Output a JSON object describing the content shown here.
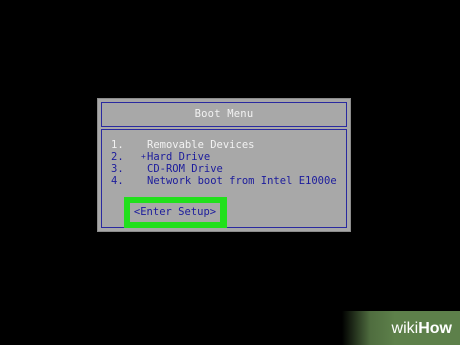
{
  "boot_menu": {
    "title": "Boot Menu",
    "items": [
      {
        "number": "1.",
        "marker": "",
        "label": "Removable Devices",
        "selected": true
      },
      {
        "number": "2.",
        "marker": "+",
        "label": "Hard Drive",
        "selected": false
      },
      {
        "number": "3.",
        "marker": "",
        "label": "CD-ROM Drive",
        "selected": false
      },
      {
        "number": "4.",
        "marker": "",
        "label": "Network boot from Intel E1000e",
        "selected": false
      }
    ],
    "setup_option": "<Enter Setup>"
  },
  "colors": {
    "background": "#000000",
    "dialog": "#a8a8a8",
    "menu_text": "#1c1c9c",
    "selected_text": "#f2f2f2",
    "highlight": "#21e01c",
    "watermark_bg": "#5d804a"
  },
  "watermark": {
    "part1": "wiki",
    "part2": "How"
  }
}
